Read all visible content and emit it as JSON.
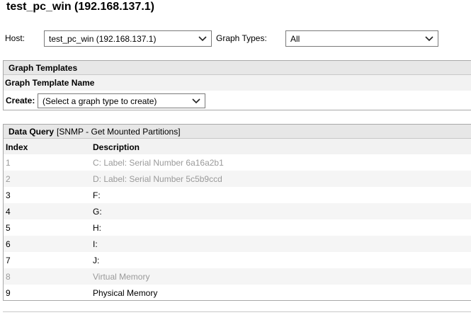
{
  "page": {
    "title": "test_pc_win (192.168.137.1)"
  },
  "filters": {
    "host_label": "Host:",
    "host_value": "test_pc_win (192.168.137.1)",
    "graph_types_label": "Graph Types:",
    "graph_types_value": "All"
  },
  "graph_templates": {
    "header": "Graph Templates",
    "column_header": "Graph Template Name",
    "create_label": "Create:",
    "create_value": "(Select a graph type to create)"
  },
  "data_query": {
    "header_bold": "Data Query",
    "header_name": "[SNMP - Get Mounted Partitions]",
    "columns": [
      "Index",
      "Description"
    ],
    "rows": [
      {
        "index": "1",
        "description": "C: Label: Serial Number 6a16a2b1",
        "disabled": true
      },
      {
        "index": "2",
        "description": "D: Label: Serial Number 5c5b9ccd",
        "disabled": true
      },
      {
        "index": "3",
        "description": "F:",
        "disabled": false
      },
      {
        "index": "4",
        "description": "G:",
        "disabled": false
      },
      {
        "index": "5",
        "description": "H:",
        "disabled": false
      },
      {
        "index": "6",
        "description": "I:",
        "disabled": false
      },
      {
        "index": "7",
        "description": "J:",
        "disabled": false
      },
      {
        "index": "8",
        "description": "Virtual Memory",
        "disabled": true
      },
      {
        "index": "9",
        "description": "Physical Memory",
        "disabled": false
      }
    ]
  },
  "colors": {
    "header_bg": "#e7e7e7",
    "row_alt_bg": "#f5f5f5",
    "disabled_text": "#9a9a9a"
  }
}
